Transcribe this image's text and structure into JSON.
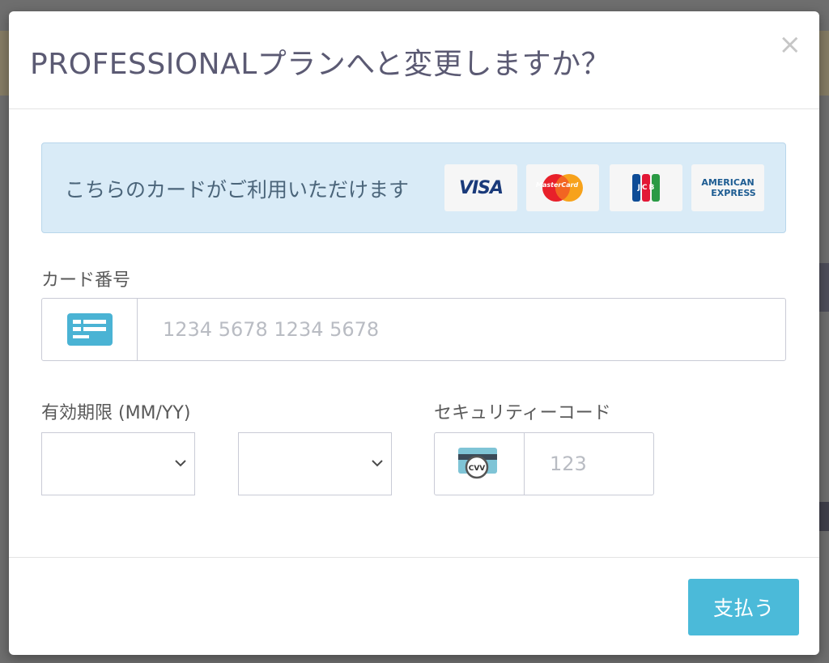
{
  "modal": {
    "title": "PROFESSIONALプランへと変更しますか？",
    "close_glyph": "×"
  },
  "card_banner": {
    "text": "こちらのカードがご利用いただけます",
    "logos": [
      {
        "name": "visa-logo",
        "label": "VISA"
      },
      {
        "name": "mastercard-logo",
        "label": "MasterCard"
      },
      {
        "name": "jcb-logo",
        "label": "JCB"
      },
      {
        "name": "amex-logo",
        "label_line1": "AMERICAN",
        "label_line2": "EXPRESS"
      }
    ]
  },
  "card_number": {
    "label": "カード番号",
    "placeholder": "1234 5678 1234 5678",
    "value": ""
  },
  "expiry": {
    "label": "有効期限 (MM/YY)",
    "month_value": "",
    "year_value": ""
  },
  "security_code": {
    "label": "セキュリティーコード",
    "placeholder": "123",
    "icon_text": "CVV"
  },
  "footer": {
    "pay_label": "支払う"
  },
  "colors": {
    "title": "#5b5a73",
    "banner_bg": "#d9ebf7",
    "pay_button": "#4bbad9",
    "card_icon": "#4ab3d4"
  }
}
